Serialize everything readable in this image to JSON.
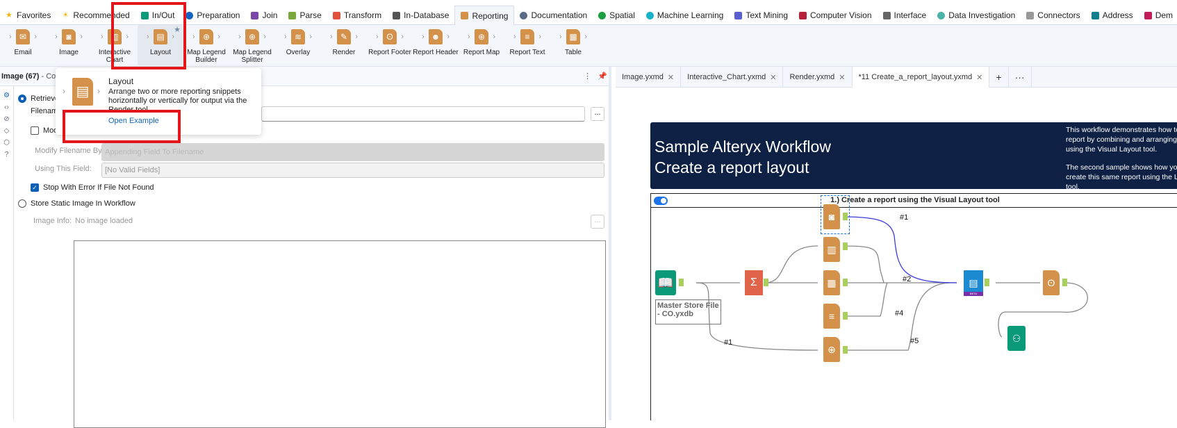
{
  "category_tabs": [
    {
      "label": "Favorites",
      "icon": "star-icon",
      "color": "#f5b50a"
    },
    {
      "label": "Recommended",
      "icon": "sun-icon",
      "color": "#f5b50a"
    },
    {
      "label": "In/Out",
      "icon": "folder-icon",
      "color": "#0a9a7a"
    },
    {
      "label": "Preparation",
      "icon": "circle-icon",
      "color": "#1565c0"
    },
    {
      "label": "Join",
      "icon": "square-icon",
      "color": "#7b47a6"
    },
    {
      "label": "Parse",
      "icon": "hex-icon",
      "color": "#7aa83a"
    },
    {
      "label": "Transform",
      "icon": "flag-icon",
      "color": "#e2533d"
    },
    {
      "label": "In-Database",
      "icon": "database-icon",
      "color": "#555"
    },
    {
      "label": "Reporting",
      "icon": "document-icon",
      "color": "#d3914a"
    },
    {
      "label": "Documentation",
      "icon": "bubble-icon",
      "color": "#5a6b85"
    },
    {
      "label": "Spatial",
      "icon": "globe-icon",
      "color": "#1b9e3e"
    },
    {
      "label": "Machine Learning",
      "icon": "circle-icon",
      "color": "#17b3c9"
    },
    {
      "label": "Text Mining",
      "icon": "hex-icon",
      "color": "#5a5fd0"
    },
    {
      "label": "Computer Vision",
      "icon": "square-icon",
      "color": "#b5223a"
    },
    {
      "label": "Interface",
      "icon": "diamond-icon",
      "color": "#666"
    },
    {
      "label": "Data Investigation",
      "icon": "circle-icon",
      "color": "#4cb3a8"
    },
    {
      "label": "Connectors",
      "icon": "hex-icon",
      "color": "#999"
    },
    {
      "label": "Address",
      "icon": "square-icon",
      "color": "#0e7e8e"
    },
    {
      "label": "Dem",
      "icon": "square-icon",
      "color": "#c21c5a"
    }
  ],
  "tools": [
    {
      "label": "Email",
      "glyph": "✉"
    },
    {
      "label": "Image",
      "glyph": "◙"
    },
    {
      "label": "Interactive Chart",
      "glyph": "▥"
    },
    {
      "label": "Layout",
      "glyph": "▤"
    },
    {
      "label": "Map Legend Builder",
      "glyph": "⊕"
    },
    {
      "label": "Map Legend Splitter",
      "glyph": "⊕"
    },
    {
      "label": "Overlay",
      "glyph": "≋"
    },
    {
      "label": "Render",
      "glyph": "✎"
    },
    {
      "label": "Report Footer",
      "glyph": "ʘ"
    },
    {
      "label": "Report Header",
      "glyph": "☻"
    },
    {
      "label": "Report Map",
      "glyph": "⊕"
    },
    {
      "label": "Report Text",
      "glyph": "≡"
    },
    {
      "label": "Table",
      "glyph": "▦"
    }
  ],
  "panel": {
    "title": "Image (67)",
    "subtitle": "- Con",
    "retrieve_label": "Retrieve",
    "filename_label": "Filename",
    "modify_label": "Mod",
    "modify_by_label": "Modify Filename By:",
    "modify_by_value": "Appending Field To Filename",
    "using_field_label": "Using This Field:",
    "using_field_value": "[No Valid Fields]",
    "stop_error_label": "Stop With Error If File Not Found",
    "store_static_label": "Store Static Image In Workflow",
    "image_info_label": "Image Info:",
    "image_info_value": "No image loaded",
    "browse": "..."
  },
  "popup": {
    "title": "Layout",
    "description": "Arrange two or more reporting snippets horizontally or vertically for output via the Render tool.",
    "link": "Open Example"
  },
  "doc_tabs": [
    {
      "label": "Image.yxmd"
    },
    {
      "label": "Interactive_Chart.yxmd"
    },
    {
      "label": "Render.yxmd"
    },
    {
      "label": "*11 Create_a_report_layout.yxmd",
      "active": true
    }
  ],
  "doc_tab_add": "+",
  "doc_tab_more": "···",
  "canvas": {
    "banner_title_1": "Sample Alteryx Workflow",
    "banner_title_2": "Create a report layout",
    "banner_text_1": "This workflow demonstrates how to create a single report by combining and arranging various elements using the Visual Layout tool.",
    "banner_text_2": "The second sample shows how you would create this same report using the Layout tool.",
    "container_title": "1.) Create a report using the Visual Layout tool",
    "input_annotation": "Master Store File - CO.yxdb",
    "beta_badge": "BETA",
    "conn_labels": [
      "#1",
      "#2",
      "#4",
      "#1",
      "#5"
    ]
  }
}
